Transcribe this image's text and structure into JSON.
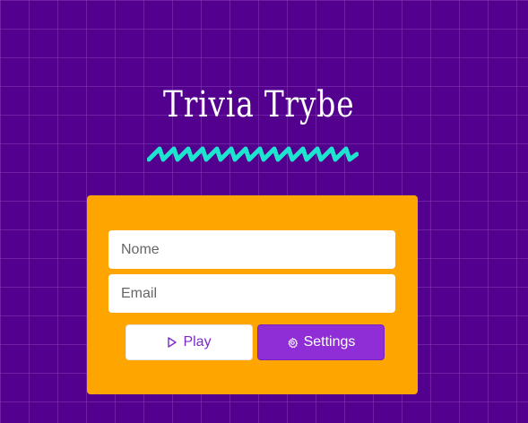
{
  "logo": {
    "title": "Trivia Trybe",
    "wave_color": "#1ee3cf"
  },
  "form": {
    "name_placeholder": "Nome",
    "email_placeholder": "Email",
    "play_label": "Play",
    "play_icon": "play-icon",
    "settings_label": "Settings",
    "settings_icon": "gear-icon"
  },
  "colors": {
    "background": "#54008f",
    "card": "#ffa500",
    "play_text": "#7b2bc8",
    "settings_button": "#8f2ed6"
  }
}
